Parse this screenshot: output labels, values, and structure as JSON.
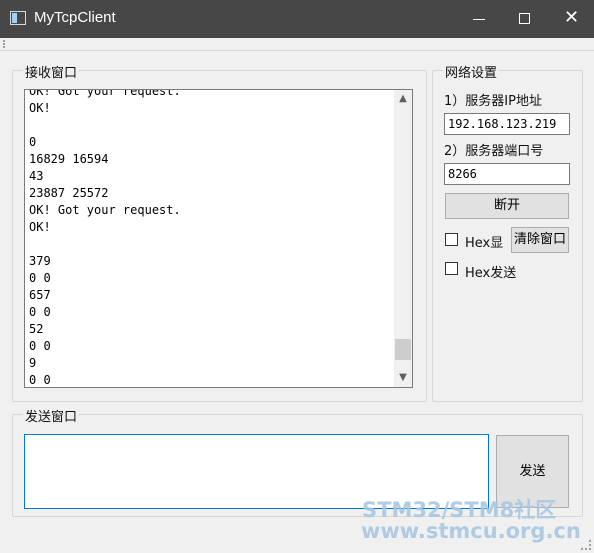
{
  "window": {
    "title": "MyTcpClient"
  },
  "receive": {
    "group_label": "接收窗口",
    "lines": [
      "OK! Got your request.",
      "OK!",
      "",
      "0",
      "16829 16594",
      "43",
      "23887 25572",
      "OK! Got your request.",
      "OK!",
      "",
      "379",
      "0 0",
      "657",
      "0 0",
      "52",
      "0 0",
      "9",
      "0 0"
    ]
  },
  "network": {
    "group_label": "网络设置",
    "ip_label": "1）服务器IP地址",
    "ip_value": "192.168.123.219",
    "port_label": "2）服务器端口号",
    "port_value": "8266",
    "disconnect_label": "断开",
    "hex_display_label": "Hex显",
    "clear_button_label": "清除窗口",
    "hex_send_label": "Hex发送"
  },
  "send": {
    "group_label": "发送窗口",
    "input_value": "",
    "send_button_label": "发送"
  },
  "watermark": {
    "line1": "STM32/STM8社区",
    "line2": "www.stmcu.org.cn"
  }
}
